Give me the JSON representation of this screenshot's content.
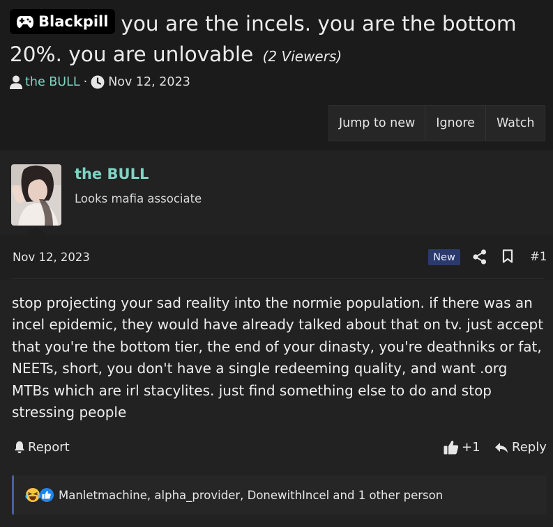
{
  "thread": {
    "prefix": "Blackpill",
    "title": "you are the incels. you are the bottom 20%. you are unlovable",
    "viewers": "(2 Viewers)",
    "author": "the BULL",
    "separator": "·",
    "date": "Nov 12, 2023"
  },
  "actions": {
    "jump_to_new": "Jump to new",
    "ignore": "Ignore",
    "watch": "Watch"
  },
  "post": {
    "username": "the BULL",
    "user_title": "Looks mafia associate",
    "date": "Nov 12, 2023",
    "new_badge": "New",
    "number": "#1",
    "body": "stop projecting your sad reality into the normie population. if there was an incel epidemic, they would have already talked about that on tv. just accept that you're the bottom tier, the end of your dinasty, you're deathniks or fat, NEETs, short, you don't have a single redeeming quality, and want .org MTBs which are irl stacylites. just find something else to do and stop stressing people",
    "report_label": "Report",
    "like_count": "+1",
    "reply_label": "Reply",
    "reactions_text": "Manletmachine, alpha_provider, DonewithIncel and 1 other person"
  },
  "colors": {
    "background": "#1b1b1b",
    "post_background": "#222222",
    "username": "#7fd5c4",
    "new_badge": "#2a3a6a",
    "reaction_border": "#4a5f9c"
  },
  "icons": {
    "prefix_icon": "gamepad-icon",
    "author_icon": "user-icon",
    "date_icon": "clock-icon",
    "share_icon": "share-icon",
    "bookmark_icon": "bookmark-icon",
    "report_icon": "bell-icon",
    "like_icon": "thumbs-up-icon",
    "reply_icon": "reply-icon",
    "reaction_icons": [
      "crying-laughing-emoji-icon",
      "like-reaction-icon"
    ]
  }
}
